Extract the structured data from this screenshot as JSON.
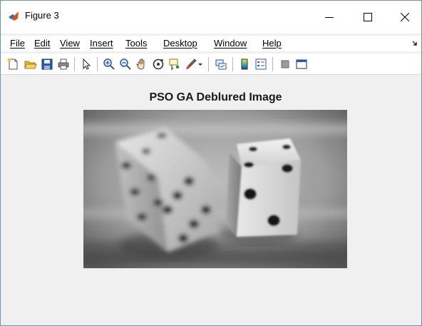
{
  "window": {
    "title": "Figure 3",
    "controls": {
      "minimize_icon": "minimize-icon",
      "maximize_icon": "maximize-icon",
      "close_icon": "close-icon"
    }
  },
  "menu": {
    "items": [
      {
        "label": "File"
      },
      {
        "label": "Edit"
      },
      {
        "label": "View"
      },
      {
        "label": "Insert"
      },
      {
        "label": "Tools"
      },
      {
        "label": "Desktop"
      },
      {
        "label": "Window"
      },
      {
        "label": "Help"
      }
    ]
  },
  "toolbar": {
    "buttons": [
      {
        "icon": "new-figure-icon"
      },
      {
        "icon": "open-file-icon"
      },
      {
        "icon": "save-icon"
      },
      {
        "icon": "print-icon"
      },
      {
        "icon": "pointer-icon"
      },
      {
        "icon": "zoom-in-icon"
      },
      {
        "icon": "zoom-out-icon"
      },
      {
        "icon": "pan-icon"
      },
      {
        "icon": "rotate-3d-icon"
      },
      {
        "icon": "data-cursor-icon"
      },
      {
        "icon": "brush-icon"
      },
      {
        "icon": "link-plot-icon"
      },
      {
        "icon": "colorbar-icon"
      },
      {
        "icon": "legend-icon"
      },
      {
        "icon": "hide-plot-tools-icon"
      },
      {
        "icon": "show-plot-tools-icon"
      }
    ]
  },
  "figure": {
    "axes_title": "PSO GA Deblured Image",
    "image_subject": "two dice"
  },
  "colors": {
    "title_bar": "#ffffff",
    "figure_background": "#f0f0f0",
    "window_border": "#6f8fb8"
  }
}
